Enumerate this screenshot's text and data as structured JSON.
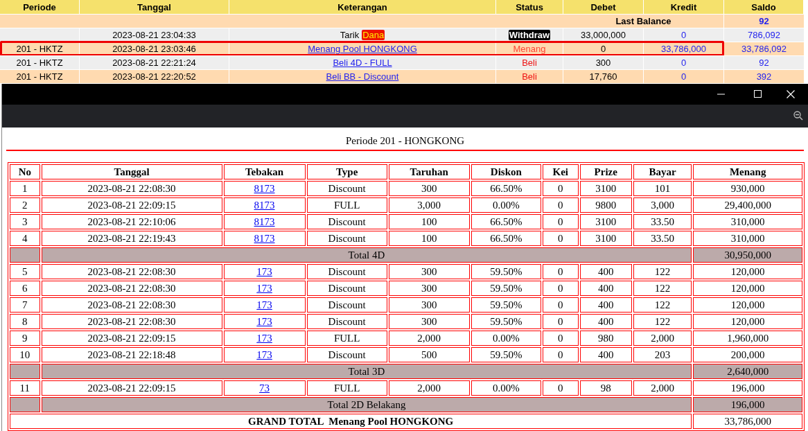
{
  "ledger": {
    "columns": [
      "Periode",
      "Tanggal",
      "Keterangan",
      "Status",
      "Debet",
      "Kredit",
      "Saldo"
    ],
    "last_balance": {
      "label": "Last Balance",
      "value": "92"
    },
    "rows": [
      {
        "periode": "",
        "tanggal": "2023-08-21 23:04:33",
        "keterangan": "Tarik",
        "keterangan_badge": "Dana",
        "link": false,
        "status": "Withdraw",
        "kind": "withdraw",
        "debet": "33,000,000",
        "kredit": "0",
        "saldo": "786,092",
        "highlighted": false
      },
      {
        "periode": "201 - HKTZ",
        "tanggal": "2023-08-21 23:03:46",
        "keterangan": "Menang Pool HONGKONG",
        "link": true,
        "status": "Menang",
        "kind": "win",
        "debet": "0",
        "kredit": "33,786,000",
        "saldo": "33,786,092",
        "highlighted": true
      },
      {
        "periode": "201 - HKTZ",
        "tanggal": "2023-08-21 22:21:24",
        "keterangan": "Beli 4D - FULL",
        "link": true,
        "status": "Beli",
        "kind": "buy",
        "debet": "300",
        "kredit": "0",
        "saldo": "92",
        "highlighted": false
      },
      {
        "periode": "201 - HKTZ",
        "tanggal": "2023-08-21 22:20:52",
        "keterangan": "Beli BB - Discount",
        "link": true,
        "status": "Beli",
        "kind": "buy",
        "debet": "17,760",
        "kredit": "0",
        "saldo": "392",
        "highlighted": false
      }
    ]
  },
  "popup": {
    "title": "Periode 201 - HONGKONG",
    "columns": [
      "No",
      "Tanggal",
      "Tebakan",
      "Type",
      "Taruhan",
      "Diskon",
      "Kei",
      "Prize",
      "Bayar",
      "Menang"
    ],
    "rows": [
      {
        "kind": "bet",
        "cells": [
          "1",
          "2023-08-21 22:08:30",
          "8173",
          "Discount",
          "300",
          "66.50%",
          "0",
          "3100",
          "101",
          "930,000"
        ]
      },
      {
        "kind": "bet",
        "cells": [
          "2",
          "2023-08-21 22:09:15",
          "8173",
          "FULL",
          "3,000",
          "0.00%",
          "0",
          "9800",
          "3,000",
          "29,400,000"
        ]
      },
      {
        "kind": "bet",
        "cells": [
          "3",
          "2023-08-21 22:10:06",
          "8173",
          "Discount",
          "100",
          "66.50%",
          "0",
          "3100",
          "33.50",
          "310,000"
        ]
      },
      {
        "kind": "bet",
        "cells": [
          "4",
          "2023-08-21 22:19:43",
          "8173",
          "Discount",
          "100",
          "66.50%",
          "0",
          "3100",
          "33.50",
          "310,000"
        ]
      },
      {
        "kind": "subtotal",
        "label": "Total 4D",
        "value": "30,950,000"
      },
      {
        "kind": "bet",
        "cells": [
          "5",
          "2023-08-21 22:08:30",
          "173",
          "Discount",
          "300",
          "59.50%",
          "0",
          "400",
          "122",
          "120,000"
        ]
      },
      {
        "kind": "bet",
        "cells": [
          "6",
          "2023-08-21 22:08:30",
          "173",
          "Discount",
          "300",
          "59.50%",
          "0",
          "400",
          "122",
          "120,000"
        ]
      },
      {
        "kind": "bet",
        "cells": [
          "7",
          "2023-08-21 22:08:30",
          "173",
          "Discount",
          "300",
          "59.50%",
          "0",
          "400",
          "122",
          "120,000"
        ]
      },
      {
        "kind": "bet",
        "cells": [
          "8",
          "2023-08-21 22:08:30",
          "173",
          "Discount",
          "300",
          "59.50%",
          "0",
          "400",
          "122",
          "120,000"
        ]
      },
      {
        "kind": "bet",
        "cells": [
          "9",
          "2023-08-21 22:09:15",
          "173",
          "FULL",
          "2,000",
          "0.00%",
          "0",
          "980",
          "2,000",
          "1,960,000"
        ]
      },
      {
        "kind": "bet",
        "cells": [
          "10",
          "2023-08-21 22:18:48",
          "173",
          "Discount",
          "500",
          "59.50%",
          "0",
          "400",
          "203",
          "200,000"
        ]
      },
      {
        "kind": "subtotal",
        "label": "Total 3D",
        "value": "2,640,000"
      },
      {
        "kind": "bet",
        "cells": [
          "11",
          "2023-08-21 22:09:15",
          "73",
          "FULL",
          "2,000",
          "0.00%",
          "0",
          "98",
          "2,000",
          "196,000"
        ]
      },
      {
        "kind": "subtotal",
        "label": "Total 2D Belakang",
        "value": "196,000"
      },
      {
        "kind": "grand_total",
        "label": "GRAND TOTAL  Menang Pool HONGKONG",
        "value": "33,786,000"
      }
    ]
  }
}
